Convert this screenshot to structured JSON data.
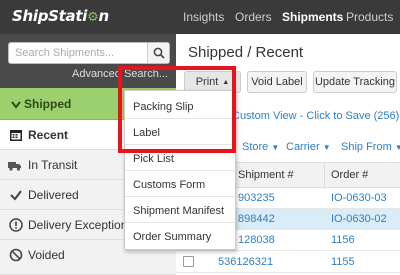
{
  "topnav": {
    "brand": "ShipStation",
    "links": [
      "Insights",
      "Orders",
      "Shipments",
      "Products"
    ],
    "active": "Shipments"
  },
  "sidebar": {
    "search_placeholder": "Search Shipments...",
    "advanced_search": "Advanced Search...",
    "parent": "Shipped",
    "items": [
      {
        "label": "Recent",
        "icon": "calendar-icon"
      },
      {
        "label": "In Transit",
        "icon": "truck-icon"
      },
      {
        "label": "Delivered",
        "icon": "check-icon"
      },
      {
        "label": "Delivery Exceptions",
        "icon": "alert-icon"
      },
      {
        "label": "Voided",
        "icon": "ban-icon"
      }
    ]
  },
  "main": {
    "title": "Shipped / Recent",
    "toolbar": {
      "print": "Print",
      "void_label": "Void Label",
      "update_tracking": "Update Tracking"
    },
    "custom_view": "Custom View - Click to Save (256)",
    "filters": [
      "Store",
      "Carrier",
      "Ship From"
    ],
    "columns": [
      "Shipment #",
      "Order #"
    ],
    "rows": [
      {
        "shipment": "903235",
        "order": "IO-0630-03"
      },
      {
        "shipment": "898442",
        "order": "IO-0630-02"
      },
      {
        "shipment": "128038",
        "order": "1156"
      },
      {
        "shipment": "536126321",
        "order": "1155"
      }
    ]
  },
  "print_menu": {
    "items": [
      "Packing Slip",
      "Label",
      "Pick List",
      "Customs Form",
      "Shipment Manifest",
      "Order Summary"
    ]
  },
  "colors": {
    "topnav_bg": "#3a3a3a",
    "sidebar_bg": "#4a4a4a",
    "shipped_green": "#9ccf6e",
    "link_blue": "#2f7fc1",
    "highlight_red": "#e8141c",
    "selected_row": "#d9ecf7"
  }
}
